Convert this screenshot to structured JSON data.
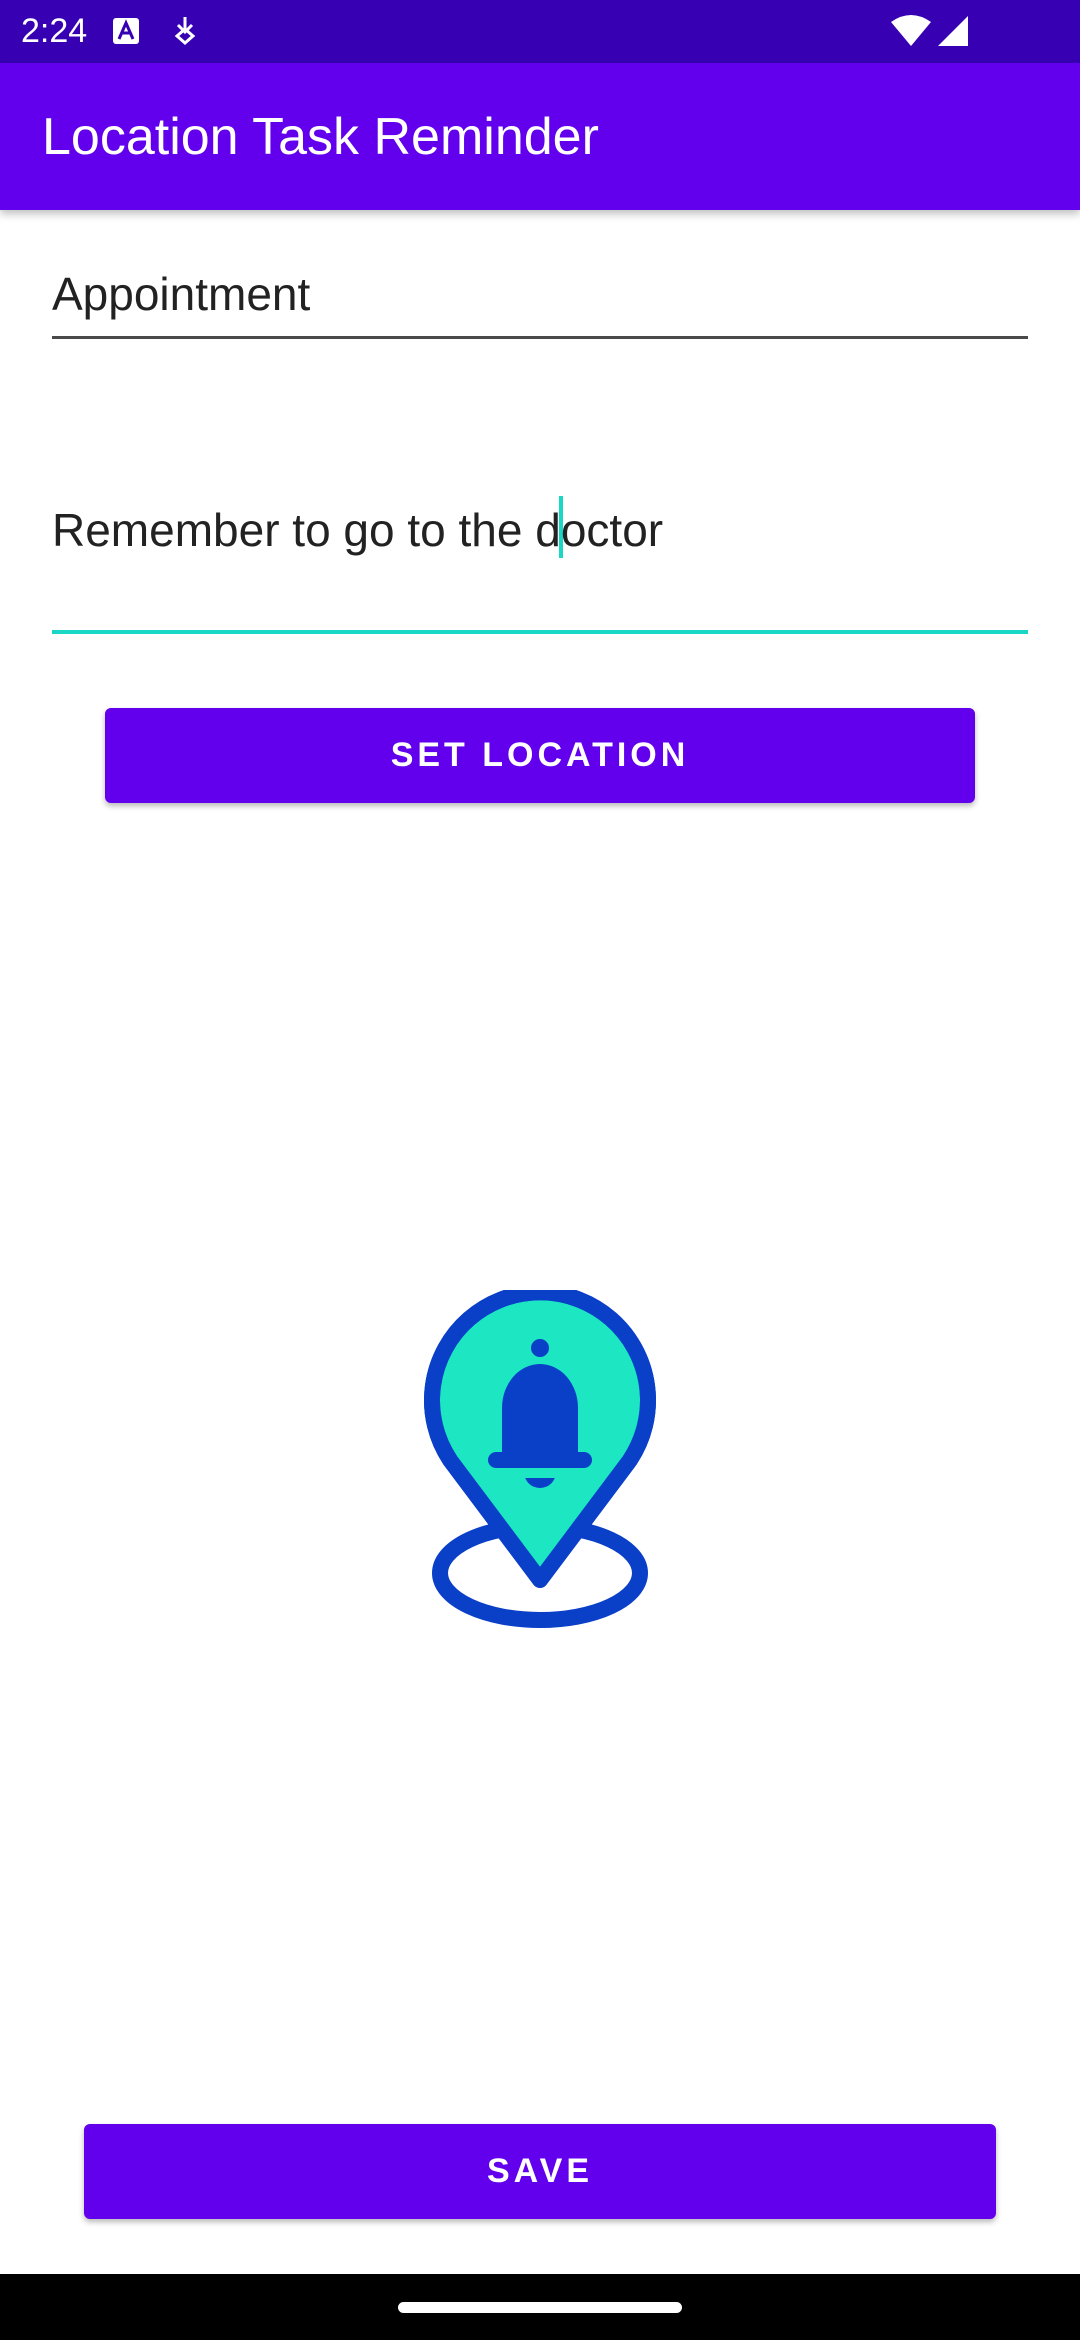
{
  "status_bar": {
    "time": "2:24",
    "icons": [
      "a-badge-icon",
      "download-arrow-icon",
      "wifi-icon",
      "signal-icon"
    ]
  },
  "app_bar": {
    "title": "Location Task Reminder"
  },
  "form": {
    "title_value": "Appointment",
    "description_before_cursor": "Remember to go to the d",
    "description_after_cursor": "octor",
    "set_location_label": "SET LOCATION",
    "save_label": "SAVE"
  },
  "hero": {
    "icon": "location-bell-icon"
  },
  "colors": {
    "status_bar": "#3700b3",
    "app_bar": "#6200ee",
    "accent": "#1ad6c4",
    "button": "#6200ee",
    "hero_outline": "#0a3fc8",
    "hero_fill": "#1de6c2"
  }
}
